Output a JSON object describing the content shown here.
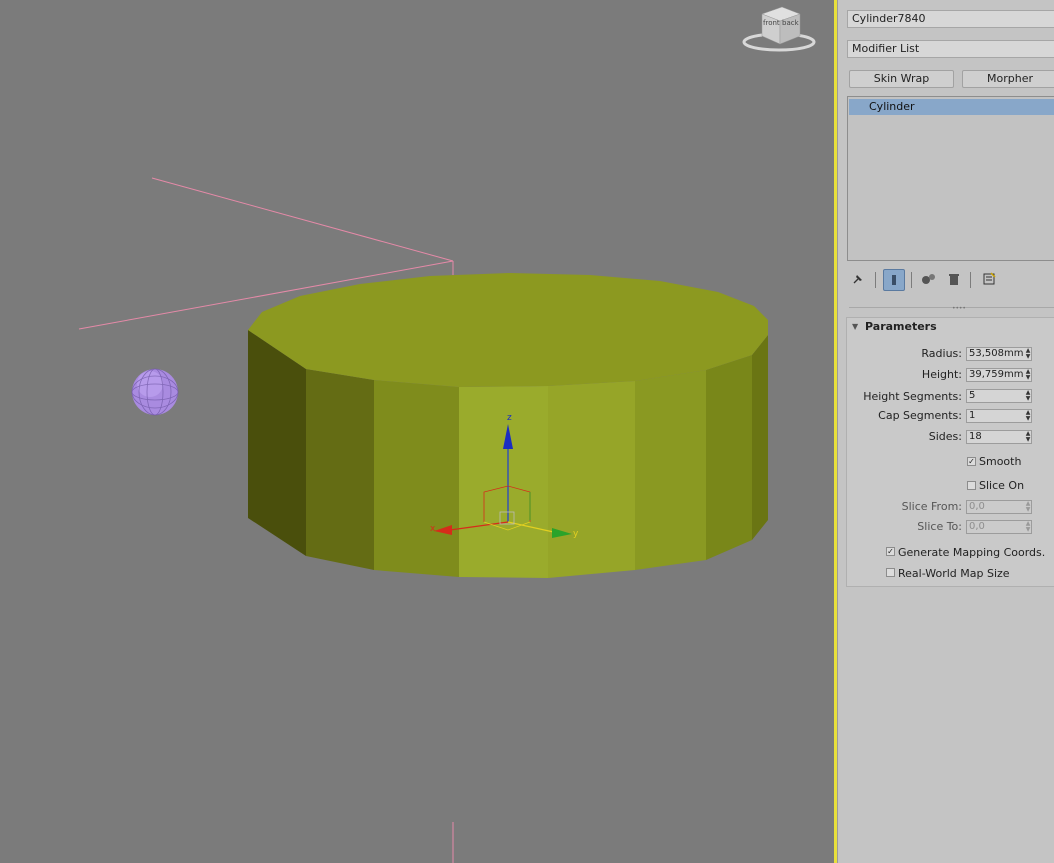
{
  "viewport": {
    "viewcube": {
      "front_label": "front",
      "back_label": "back"
    },
    "gizmo": {
      "x_label": "x",
      "y_label": "y",
      "z_label": "z"
    }
  },
  "panel": {
    "object_name": "Cylinder7840",
    "modifier_list_label": "Modifier List",
    "buttons": {
      "skin_wrap": "Skin Wrap",
      "morpher": "Morpher"
    },
    "stack_items": [
      "Cylinder"
    ],
    "parameters": {
      "title": "Parameters",
      "radius_label": "Radius:",
      "radius_value": "53,508mm",
      "height_label": "Height:",
      "height_value": "39,759mm",
      "height_segments_label": "Height Segments:",
      "height_segments_value": "5",
      "cap_segments_label": "Cap Segments:",
      "cap_segments_value": "1",
      "sides_label": "Sides:",
      "sides_value": "18",
      "smooth_label": "Smooth",
      "smooth_checked": true,
      "slice_on_label": "Slice On",
      "slice_on_checked": false,
      "slice_from_label": "Slice From:",
      "slice_from_value": "0,0",
      "slice_to_label": "Slice To:",
      "slice_to_value": "0,0",
      "gen_mapping_label": "Generate Mapping Coords.",
      "gen_mapping_checked": true,
      "real_world_label": "Real-World Map Size",
      "real_world_checked": false
    }
  },
  "colors": {
    "viewport_bg": "#7b7b7b",
    "cylinder_top": "#8c9920",
    "cylinder_side_mid": "#9aab2c",
    "cylinder_side_dark": "#4a4f0c",
    "sphere": "#a98be0",
    "camera_lines": "#e58aa8",
    "selection_accent": "#e8e03c",
    "stack_highlight": "#88a7c9"
  }
}
